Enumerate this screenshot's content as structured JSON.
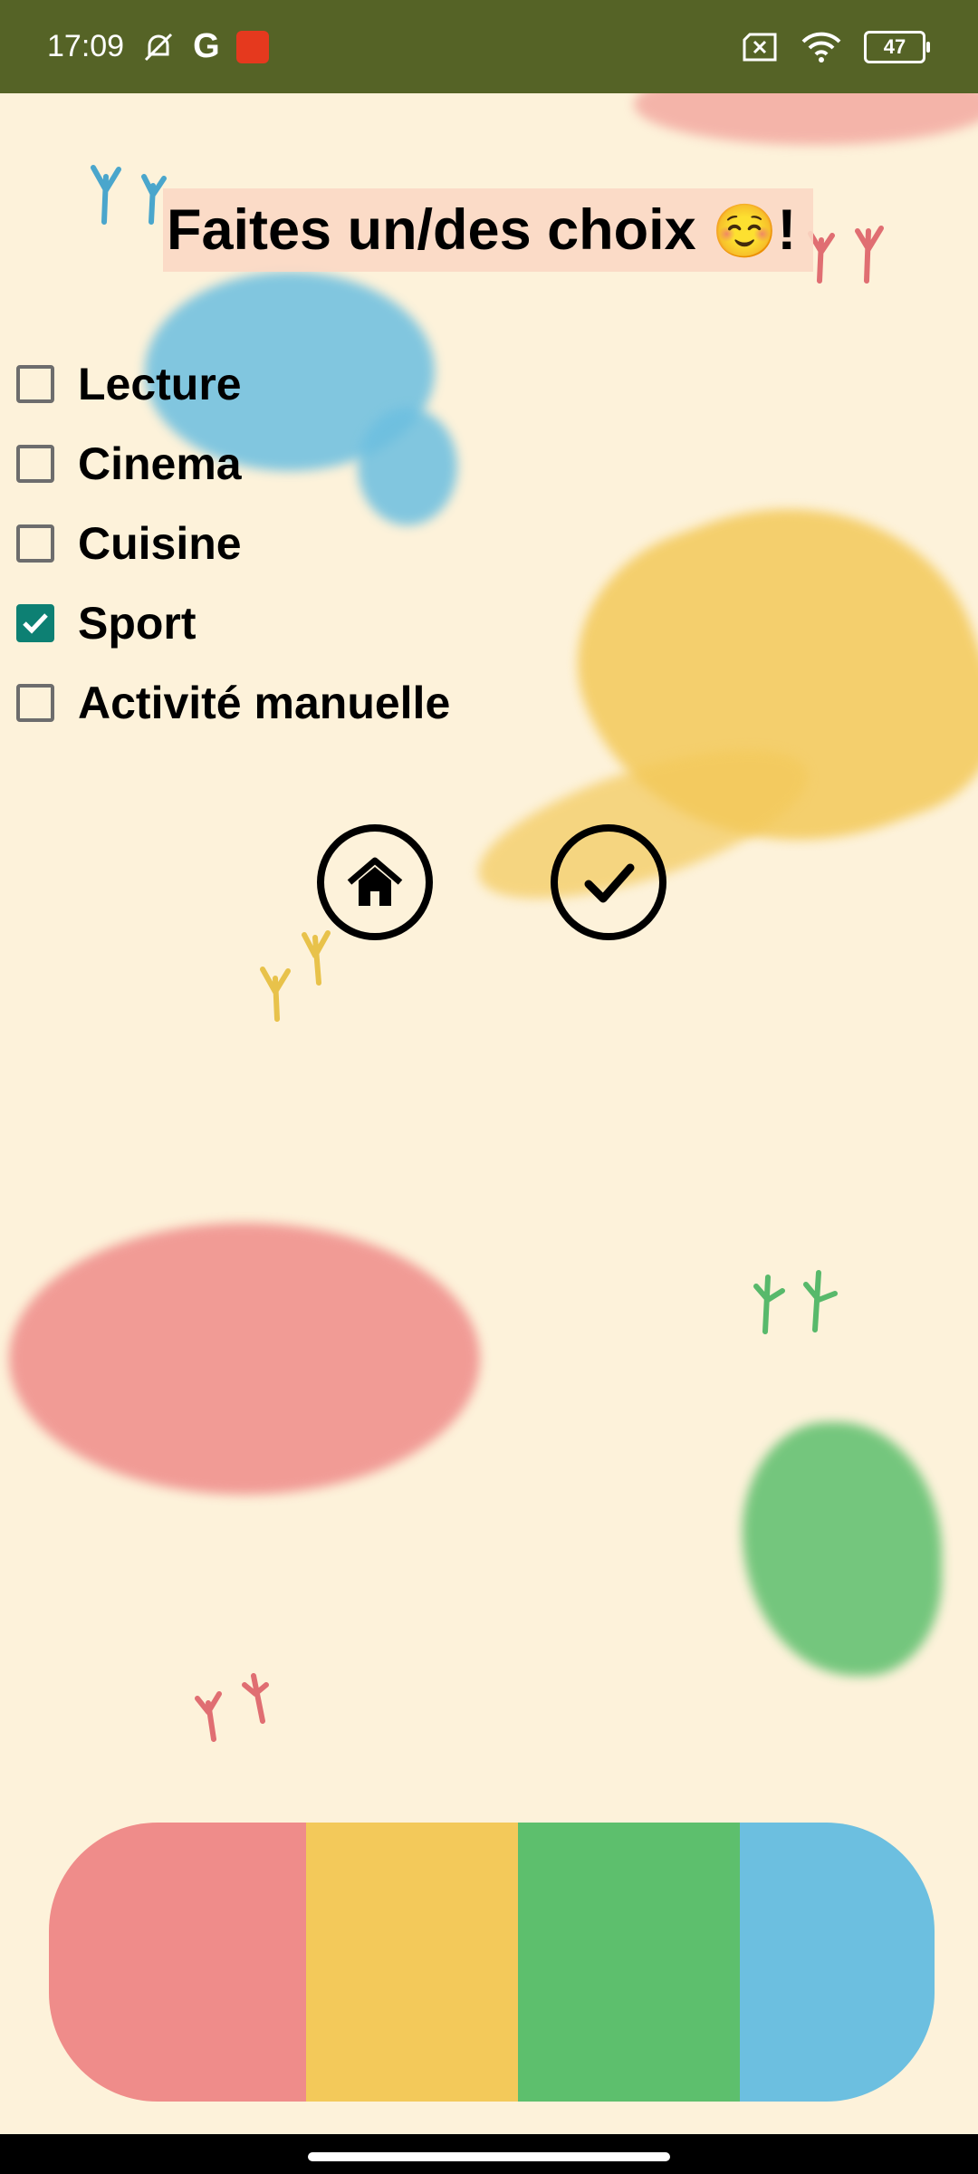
{
  "status_bar": {
    "time": "17:09",
    "g_label": "G",
    "battery_level": "47",
    "icons": [
      "mute-alarm-icon",
      "google-icon",
      "aliexpress-icon",
      "no-sim-icon",
      "wifi-icon",
      "battery-icon"
    ]
  },
  "page": {
    "title": "Faites un/des choix",
    "title_emoji": "☺️",
    "title_suffix": "!"
  },
  "options": [
    {
      "label": "Lecture",
      "checked": false
    },
    {
      "label": "Cinema",
      "checked": false
    },
    {
      "label": "Cuisine",
      "checked": false
    },
    {
      "label": "Sport",
      "checked": true
    },
    {
      "label": "Activité manuelle",
      "checked": false
    }
  ],
  "actions": {
    "home_icon": "home-icon",
    "confirm_icon": "check-icon"
  },
  "colors": {
    "status_bar": "#556326",
    "background": "#fdf2da",
    "checkbox_checked": "#0d8073",
    "red": "#ef8c8a",
    "yellow": "#f3c95a",
    "green": "#5dbf6d",
    "blue": "#6cbfe0"
  }
}
